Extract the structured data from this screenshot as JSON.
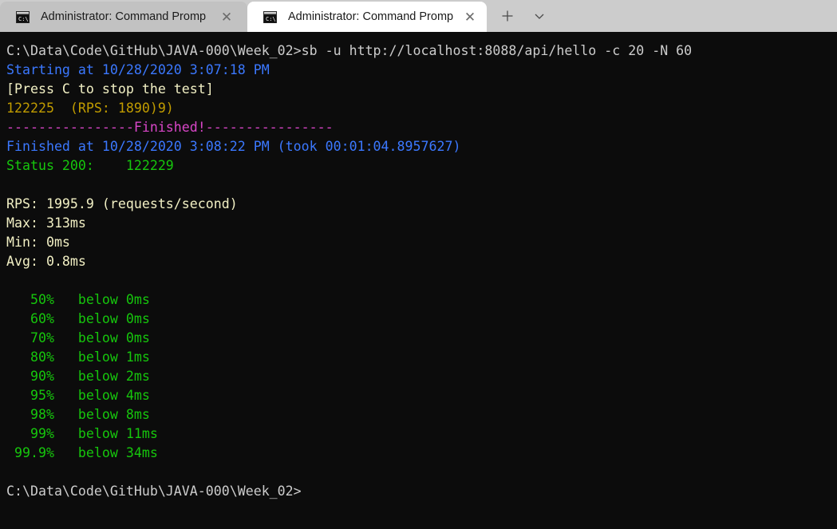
{
  "window": {
    "title": "Administrator: Command Prompt",
    "tabs": [
      {
        "label": "Administrator: Command Promp",
        "icon": "console-icon",
        "close_glyph": "✕",
        "active": false
      },
      {
        "label": "Administrator: Command Promp",
        "icon": "console-icon",
        "close_glyph": "✕",
        "active": true
      }
    ],
    "actions": {
      "new_tab_label": "+",
      "dropdown_label": "⌄"
    }
  },
  "colors": {
    "background": "#0c0c0c",
    "titlebar": "#cccccc",
    "active_tab": "#ffffff",
    "inactive_tab": "#c2c2c2",
    "white": "#cccccc",
    "blue": "#3b78ff",
    "cream": "#f2f0c4",
    "gold": "#c19c00",
    "magenta": "#d946c8",
    "green": "#16c60c"
  },
  "terminal": {
    "prompt_path": "C:\\Data\\Code\\GitHub\\JAVA-000\\Week_02>",
    "command": "sb -u http://localhost:8088/api/hello -c 20 -N 60",
    "lines": [
      {
        "id": "command-line",
        "color": "white",
        "text": "C:\\Data\\Code\\GitHub\\JAVA-000\\Week_02>sb -u http://localhost:8088/api/hello -c 20 -N 60"
      },
      {
        "id": "starting-line",
        "color": "blue",
        "text": "Starting at 10/28/2020 3:07:18 PM"
      },
      {
        "id": "press-stop-hint",
        "color": "cream",
        "text": "[Press C to stop the test]"
      },
      {
        "id": "progress-counter",
        "color": "gold",
        "text": "122225  (RPS: 1890)9)"
      },
      {
        "id": "finished-divider",
        "color": "magenta",
        "text": "----------------Finished!----------------"
      },
      {
        "id": "finished-line",
        "color": "blue",
        "text": "Finished at 10/28/2020 3:08:22 PM (took 00:01:04.8957627)"
      },
      {
        "id": "status-line",
        "color": "green",
        "text": "Status 200:    122229"
      },
      {
        "id": "blank-1",
        "color": "white",
        "text": ""
      },
      {
        "id": "rps-line",
        "color": "cream",
        "text": "RPS: 1995.9 (requests/second)"
      },
      {
        "id": "max-line",
        "color": "cream",
        "text": "Max: 313ms"
      },
      {
        "id": "min-line",
        "color": "cream",
        "text": "Min: 0ms"
      },
      {
        "id": "avg-line",
        "color": "cream",
        "text": "Avg: 0.8ms"
      },
      {
        "id": "blank-2",
        "color": "white",
        "text": ""
      },
      {
        "id": "pct-50",
        "color": "green",
        "text": "   50%   below 0ms"
      },
      {
        "id": "pct-60",
        "color": "green",
        "text": "   60%   below 0ms"
      },
      {
        "id": "pct-70",
        "color": "green",
        "text": "   70%   below 0ms"
      },
      {
        "id": "pct-80",
        "color": "green",
        "text": "   80%   below 1ms"
      },
      {
        "id": "pct-90",
        "color": "green",
        "text": "   90%   below 2ms"
      },
      {
        "id": "pct-95",
        "color": "green",
        "text": "   95%   below 4ms"
      },
      {
        "id": "pct-98",
        "color": "green",
        "text": "   98%   below 8ms"
      },
      {
        "id": "pct-99",
        "color": "green",
        "text": "   99%   below 11ms"
      },
      {
        "id": "pct-999",
        "color": "green",
        "text": " 99.9%   below 34ms"
      },
      {
        "id": "blank-3",
        "color": "white",
        "text": ""
      },
      {
        "id": "final-prompt",
        "color": "white",
        "text": "C:\\Data\\Code\\GitHub\\JAVA-000\\Week_02>"
      }
    ],
    "summary": {
      "started_at": "10/28/2020 3:07:18 PM",
      "finished_at": "10/28/2020 3:08:22 PM",
      "duration": "00:01:04.8957627",
      "requests_total": "122225",
      "live_rps": "1890",
      "status_200_count": "122229",
      "rps": "1995.9",
      "max_ms": "313ms",
      "min_ms": "0ms",
      "avg_ms": "0.8ms"
    },
    "percentiles": [
      {
        "label": "50%",
        "value": "below 0ms"
      },
      {
        "label": "60%",
        "value": "below 0ms"
      },
      {
        "label": "70%",
        "value": "below 0ms"
      },
      {
        "label": "80%",
        "value": "below 1ms"
      },
      {
        "label": "90%",
        "value": "below 2ms"
      },
      {
        "label": "95%",
        "value": "below 4ms"
      },
      {
        "label": "98%",
        "value": "below 8ms"
      },
      {
        "label": "99%",
        "value": "below 11ms"
      },
      {
        "label": "99.9%",
        "value": "below 34ms"
      }
    ]
  }
}
